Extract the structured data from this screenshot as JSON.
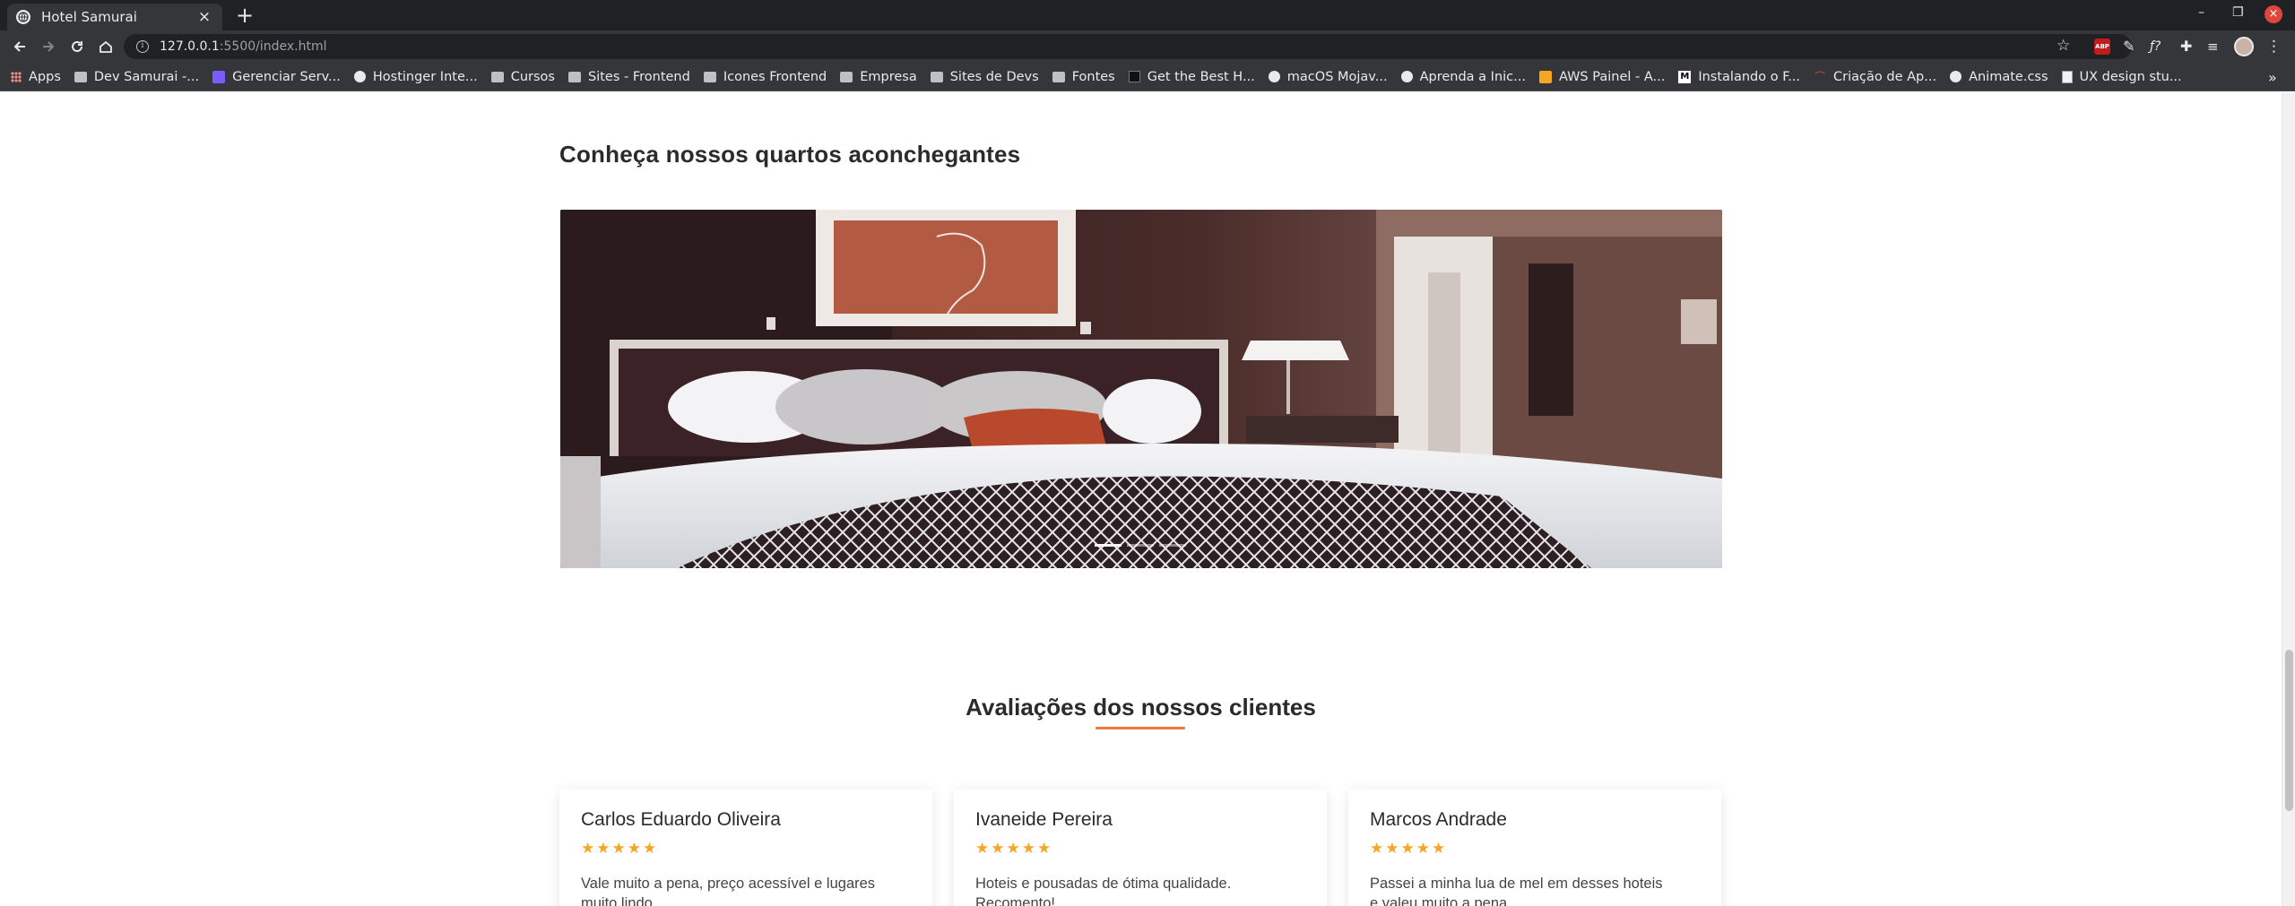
{
  "browser": {
    "tab_title": "Hotel Samurai",
    "url_host": "127.0.0.1",
    "url_path": ":5500/index.html",
    "bookmarks": [
      {
        "label": "Apps",
        "icon": "apps-grid-icon"
      },
      {
        "label": "Dev Samurai -...",
        "icon": "folder-icon"
      },
      {
        "label": "Gerenciar Serv...",
        "icon": "site-icon"
      },
      {
        "label": "Hostinger Inte...",
        "icon": "globe-icon"
      },
      {
        "label": "Cursos",
        "icon": "folder-icon"
      },
      {
        "label": "Sites - Frontend",
        "icon": "folder-icon"
      },
      {
        "label": "Icones Frontend",
        "icon": "folder-icon"
      },
      {
        "label": "Empresa",
        "icon": "folder-icon"
      },
      {
        "label": "Sites de Devs",
        "icon": "folder-icon"
      },
      {
        "label": "Fontes",
        "icon": "folder-icon"
      },
      {
        "label": "Get the Best H...",
        "icon": "site-icon"
      },
      {
        "label": "macOS Mojav...",
        "icon": "globe-icon"
      },
      {
        "label": "Aprenda a Inic...",
        "icon": "globe-icon"
      },
      {
        "label": "AWS Painel - A...",
        "icon": "aws-icon"
      },
      {
        "label": "Instalando o F...",
        "icon": "medium-icon"
      },
      {
        "label": "Criação de Ap...",
        "icon": "site-icon"
      },
      {
        "label": "Animate.css",
        "icon": "globe-icon"
      },
      {
        "label": "UX design stu...",
        "icon": "doc-icon"
      }
    ]
  },
  "page": {
    "rooms_title": "Conheça nossos quartos aconchegantes",
    "carousel": {
      "slide_count": 3,
      "active_index": 0
    },
    "reviews_title": "Avaliações dos nossos clientes",
    "reviews": [
      {
        "name": "Carlos Eduardo Oliveira",
        "stars": "★★★★★",
        "text": "Vale muito a pena, preço acessível e lugares muito lindo."
      },
      {
        "name": "Ivaneide Pereira",
        "stars": "★★★★★",
        "text": "Hoteis e pousadas de ótima qualidade. Recomento!"
      },
      {
        "name": "Marcos Andrade",
        "stars": "★★★★★",
        "text": "Passei a minha lua de mel em desses hoteis e valeu muito a pena."
      }
    ]
  },
  "colors": {
    "accent": "#f07a3c",
    "star": "#f5a623",
    "chrome_dark": "#202124",
    "chrome": "#35363a"
  }
}
